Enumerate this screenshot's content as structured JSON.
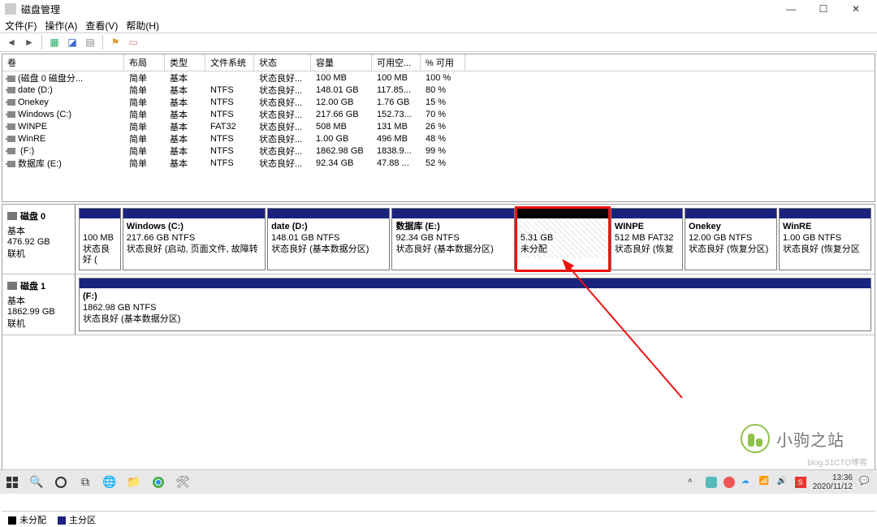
{
  "window": {
    "title": "磁盘管理",
    "min": "—",
    "max": "☐",
    "close": "✕"
  },
  "menu": {
    "file": "文件(F)",
    "action": "操作(A)",
    "view": "查看(V)",
    "help": "帮助(H)"
  },
  "columns": {
    "volume": "卷",
    "layout": "布局",
    "type": "类型",
    "fs": "文件系统",
    "status": "状态",
    "capacity": "容量",
    "free": "可用空...",
    "pctfree": "% 可用"
  },
  "volumes": [
    {
      "name": "(磁盘 0 磁盘分...",
      "layout": "简单",
      "type": "基本",
      "fs": "",
      "status": "状态良好...",
      "cap": "100 MB",
      "free": "100 MB",
      "pct": "100 %"
    },
    {
      "name": "date (D:)",
      "layout": "简单",
      "type": "基本",
      "fs": "NTFS",
      "status": "状态良好...",
      "cap": "148.01 GB",
      "free": "117.85...",
      "pct": "80 %"
    },
    {
      "name": "Onekey",
      "layout": "简单",
      "type": "基本",
      "fs": "NTFS",
      "status": "状态良好...",
      "cap": "12.00 GB",
      "free": "1.76 GB",
      "pct": "15 %"
    },
    {
      "name": "Windows (C:)",
      "layout": "简单",
      "type": "基本",
      "fs": "NTFS",
      "status": "状态良好...",
      "cap": "217.66 GB",
      "free": "152.73...",
      "pct": "70 %"
    },
    {
      "name": "WINPE",
      "layout": "简单",
      "type": "基本",
      "fs": "FAT32",
      "status": "状态良好...",
      "cap": "508 MB",
      "free": "131 MB",
      "pct": "26 %"
    },
    {
      "name": "WinRE",
      "layout": "简单",
      "type": "基本",
      "fs": "NTFS",
      "status": "状态良好...",
      "cap": "1.00 GB",
      "free": "496 MB",
      "pct": "48 %"
    },
    {
      "name": "             (F:)",
      "layout": "简单",
      "type": "基本",
      "fs": "NTFS",
      "status": "状态良好...",
      "cap": "1862.98 GB",
      "free": "1838.9...",
      "pct": "99 %"
    },
    {
      "name": "数据库 (E:)",
      "layout": "简单",
      "type": "基本",
      "fs": "NTFS",
      "status": "状态良好...",
      "cap": "92.34 GB",
      "free": "47.88 ...",
      "pct": "52 %"
    }
  ],
  "disks": [
    {
      "name": "磁盘 0",
      "type": "基本",
      "size": "476.92 GB",
      "state": "联机",
      "parts": [
        {
          "title": "",
          "line2": "100 MB",
          "line3": "状态良好 (",
          "flex": 4,
          "cls": ""
        },
        {
          "title": "Windows  (C:)",
          "line2": "217.66 GB NTFS",
          "line3": "状态良好 (启动, 页面文件, 故障转",
          "flex": 14,
          "cls": ""
        },
        {
          "title": "date  (D:)",
          "line2": "148.01 GB NTFS",
          "line3": "状态良好 (基本数据分区)",
          "flex": 12,
          "cls": ""
        },
        {
          "title": "数据库  (E:)",
          "line2": "92.34 GB NTFS",
          "line3": "状态良好 (基本数据分区)",
          "flex": 12,
          "cls": ""
        },
        {
          "title": "",
          "line2": "5.31 GB",
          "line3": "未分配",
          "flex": 9,
          "cls": "unalloc red-highlight"
        },
        {
          "title": "WINPE",
          "line2": "512 MB FAT32",
          "line3": "状态良好 (恢复",
          "flex": 7,
          "cls": ""
        },
        {
          "title": "Onekey",
          "line2": "12.00 GB NTFS",
          "line3": "状态良好 (恢复分区)",
          "flex": 9,
          "cls": ""
        },
        {
          "title": "WinRE",
          "line2": "1.00 GB NTFS",
          "line3": "状态良好 (恢复分区",
          "flex": 9,
          "cls": ""
        }
      ]
    },
    {
      "name": "磁盘 1",
      "type": "基本",
      "size": "1862.99 GB",
      "state": "联机",
      "parts": [
        {
          "title": "             (F:)",
          "line2": "1862.98 GB NTFS",
          "line3": "状态良好 (基本数据分区)",
          "flex": 1,
          "cls": ""
        }
      ]
    }
  ],
  "legend": {
    "unalloc": "未分配",
    "primary": "主分区"
  },
  "watermark": {
    "text": "小驹之站",
    "sub": "blog.51CTO博客"
  },
  "tray": {
    "time": "13:36",
    "date": "2020/11/12"
  }
}
